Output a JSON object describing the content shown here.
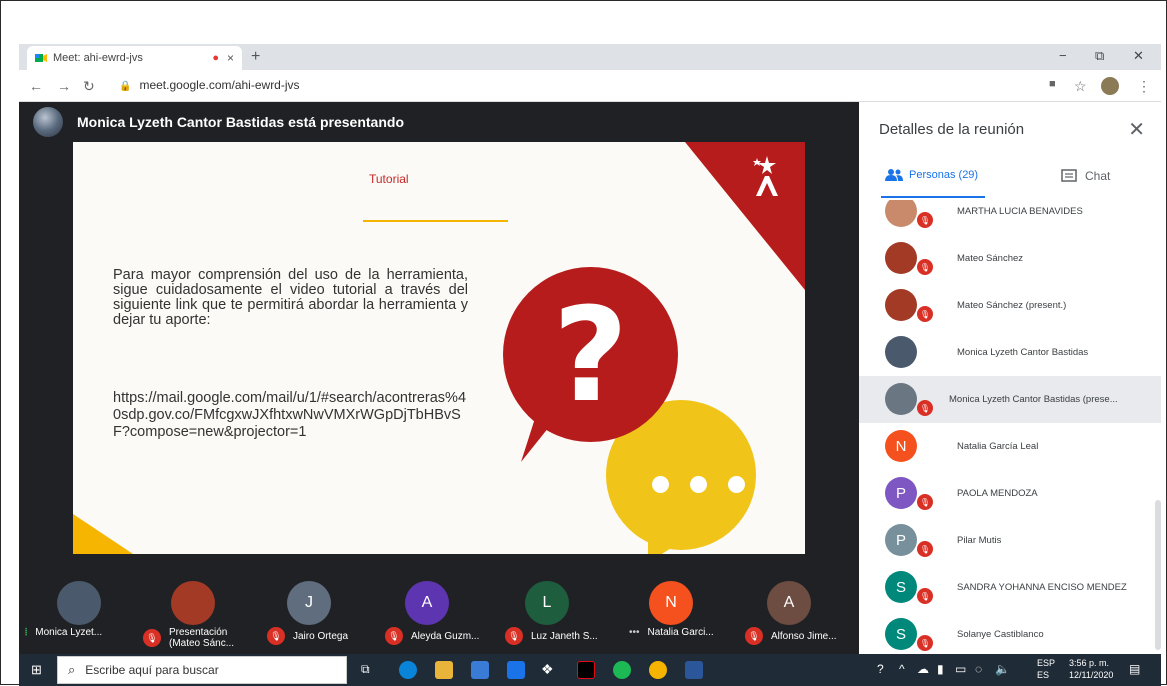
{
  "browser": {
    "tab_title": "Meet: ahi-ewrd-jvs",
    "tab_close": "×",
    "new_tab": "+",
    "url": "meet.google.com/ahi-ewrd-jvs",
    "win_min": "−",
    "win_max": "⧉",
    "win_close": "✕"
  },
  "presenter": {
    "text": "Monica Lyzeth Cantor Bastidas está presentando"
  },
  "slide": {
    "title": "Tutorial",
    "body": "Para mayor comprensión del uso de la herramienta, sigue cuidadosamente el video tutorial a través del siguiente link que te permitirá abordar la herramienta y dejar tu aporte:",
    "link": "https://mail.google.com/mail/u/1/#search/acontreras%40sdp.gov.co/FMfcgxwJXfhtxwNwVMXrWGpDjTbHBvSF?compose=new&projector=1",
    "qmark": "?"
  },
  "strip": [
    {
      "initial": "",
      "label": "Monica Lyzet...",
      "color": "#4a5a6c",
      "indicator": "speaking"
    },
    {
      "initial": "",
      "label": "Presentación (Mateo Sánc...",
      "color": "#a33a26",
      "indicator": "muted"
    },
    {
      "initial": "J",
      "label": "Jairo Ortega",
      "color": "#5f6d7e",
      "indicator": "muted"
    },
    {
      "initial": "A",
      "label": "Aleyda Guzm...",
      "color": "#5e35b1",
      "indicator": "muted"
    },
    {
      "initial": "L",
      "label": "Luz Janeth S...",
      "color": "#1e5e3e",
      "indicator": "muted"
    },
    {
      "initial": "N",
      "label": "Natalia Garci...",
      "color": "#f4511e",
      "indicator": "dots"
    },
    {
      "initial": "A",
      "label": "Alfonso Jime...",
      "color": "#6d4c41",
      "indicator": "muted"
    }
  ],
  "panel": {
    "title": "Detalles de la reunión",
    "close": "✕",
    "people_tab": "Personas (29)",
    "chat_tab": "Chat",
    "participants": [
      {
        "name": "MARTHA LUCIA BENAVIDES",
        "initial": "",
        "color": "#c98a6b",
        "mute": true
      },
      {
        "name": "Mateo Sánchez",
        "initial": "",
        "color": "#a33a26",
        "mute": true
      },
      {
        "name": "Mateo Sánchez (present.)",
        "initial": "",
        "color": "#a33a26",
        "mute": true
      },
      {
        "name": "Monica Lyzeth Cantor Bastidas",
        "initial": "",
        "color": "#4a5a6c",
        "mute": false
      },
      {
        "name": "Monica Lyzeth Cantor Bastidas (prese...",
        "initial": "",
        "color": "#6b7683",
        "mute": true
      },
      {
        "name": "Natalia García Leal",
        "initial": "N",
        "color": "#f4511e",
        "mute": false
      },
      {
        "name": "PAOLA MENDOZA",
        "initial": "P",
        "color": "#7e57c2",
        "mute": true
      },
      {
        "name": "Pilar Mutis",
        "initial": "P",
        "color": "#78909c",
        "mute": true
      },
      {
        "name": "SANDRA YOHANNA ENCISO MENDEZ",
        "initial": "S",
        "color": "#00897b",
        "mute": true
      },
      {
        "name": "Solanye Castiblanco",
        "initial": "S",
        "color": "#00897b",
        "mute": true
      }
    ]
  },
  "taskbar": {
    "search_placeholder": "Escribe aquí para buscar",
    "lang1": "ESP",
    "lang2": "ES",
    "time": "3:56 p. m.",
    "date": "12/11/2020"
  }
}
